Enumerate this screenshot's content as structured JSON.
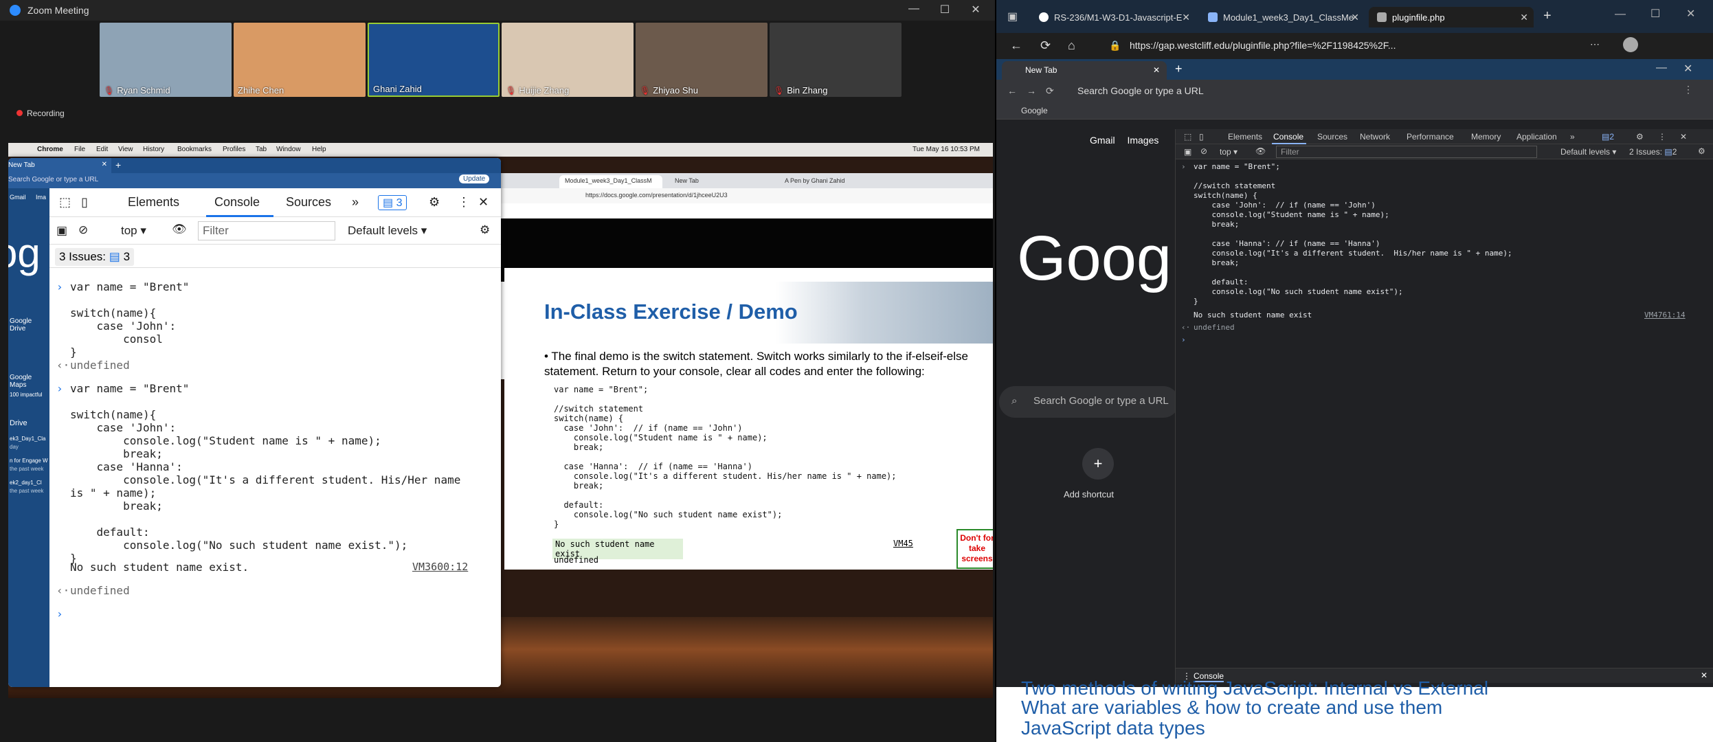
{
  "zoom": {
    "title": "Zoom Meeting",
    "recording": "Recording",
    "participants": [
      {
        "name": "Ryan Schmid",
        "bg": "#8ea3b5"
      },
      {
        "name": "Zhihe Chen",
        "bg": "#d99a64"
      },
      {
        "name": "Ghani Zahid",
        "bg": "#1d4e8f"
      },
      {
        "name": "Huijie Zhang",
        "bg": "#d9c7b2"
      },
      {
        "name": "Zhiyao Shu",
        "bg": "#6c5a4c"
      },
      {
        "name": "Bin Zhang",
        "bg": "#3a3a3a"
      }
    ]
  },
  "mac_menubar": {
    "items": [
      "Chrome",
      "File",
      "Edit",
      "View",
      "History",
      "Bookmarks",
      "Profiles",
      "Tab",
      "Window",
      "Help"
    ],
    "clock": "Tue May 16  10:53 PM"
  },
  "shared_chrome_front": {
    "tab": "New Tab",
    "address": "Search Google or type a URL",
    "update": "Update",
    "sidebar": [
      "Gmail",
      "Ima",
      "Google Drive",
      "Google Maps",
      "100 impactful",
      "Drive",
      "ek3_Day1_Cla",
      "day",
      "n for Engage W",
      "the past week",
      "ek2_day1_Cl",
      "the past week"
    ],
    "devtools": {
      "tabs": [
        "Elements",
        "Console",
        "Sources"
      ],
      "issues_badge": "3",
      "context": "top",
      "filter_placeholder": "Filter",
      "levels": "Default levels",
      "issues_label": "3 Issues:",
      "issues_count": "3"
    },
    "console": {
      "entry1": "var name = \"Brent\"\n\nswitch(name){\n    case 'John':\n        consol\n}",
      "out1": "undefined",
      "entry2_lines": [
        "var name = \"Brent\"",
        "",
        "switch(name){",
        "    case 'John':",
        "        console.log(\"Student name is \" + name);",
        "        break;",
        "    case 'Hanna':",
        "        console.log(\"It's a different student. His/Her name",
        "is \" + name);",
        "        break;",
        "",
        "    default:",
        "        console.log(\"No such student name exist.\");",
        "}"
      ],
      "result": "No such student name exist.",
      "result_src": "VM3600:12",
      "out2": "undefined"
    }
  },
  "shared_chrome_back": {
    "tabs": [
      "Module1_week3_Day1_ClassM",
      "New Tab",
      "A Pen by Ghani Zahid"
    ],
    "url": "https://docs.google.com/presentation/d/1jhceeU2U3"
  },
  "slide": {
    "title": "In-Class Exercise / Demo",
    "bullet": "The final demo is the switch statement. Switch works similarly to the if-elseif-else statement. Return to your console, clear all codes and enter the following:",
    "code": "var name = \"Brent\";\n\n//switch statement\nswitch(name) {\n  case 'John':  // if (name == 'John')\n    console.log(\"Student name is \" + name);\n    break;\n\n  case 'Hanna':  // if (name == 'Hanna')\n    console.log(\"It's a different student. His/her name is \" + name);\n    break;\n\n  default:\n    console.log(\"No such student name exist\");\n}",
    "output": "No such student name exist",
    "output_src": "VM45",
    "undefined": "undefined",
    "note": "Don't for take screens"
  },
  "browser": {
    "tabs": [
      {
        "label": "RS-236/M1-W3-D1-Javascript-E",
        "fav": "#ffffff"
      },
      {
        "label": "Module1_week3_Day1_ClassMe",
        "fav": "#8ab4f8"
      },
      {
        "label": "pluginfile.php",
        "fav": "#aaaaaa"
      }
    ],
    "url": "https://gap.westcliff.edu/pluginfile.php?file=%2F1198425%2F...",
    "inner": {
      "tab": "New Tab",
      "address": "Search Google or type a URL",
      "bookmark": "Google",
      "links": [
        "Gmail",
        "Images"
      ],
      "logo": "Googl",
      "search": "Search Google or type a URL",
      "shortcut": "Add shortcut"
    },
    "devtools": {
      "tabs": [
        "Elements",
        "Console",
        "Sources",
        "Network",
        "Performance",
        "Memory",
        "Application"
      ],
      "badge": "2",
      "context": "top",
      "filter_placeholder": "Filter",
      "levels": "Default levels",
      "issues": "2 Issues:",
      "issues_count": "2",
      "code_lines": [
        "var name = \"Brent\";",
        "",
        "//switch statement",
        "switch(name) {",
        "    case 'John':  // if (name == 'John')",
        "    console.log(\"Student name is \" + name);",
        "    break;",
        "",
        "    case 'Hanna': // if (name == 'Hanna')",
        "    console.log(\"It's a different student.  His/her name is \" + name);",
        "    break;",
        "",
        "    default:",
        "    console.log(\"No such student name exist\");",
        "}"
      ],
      "result": "No such student name exist",
      "result_src": "VM4761:14",
      "out": "undefined",
      "drawer": "Console"
    },
    "doc_lines": [
      "Two methods of writing JavaScript: Internal vs External",
      "What are variables & how to create and use them",
      "JavaScript data types"
    ]
  }
}
